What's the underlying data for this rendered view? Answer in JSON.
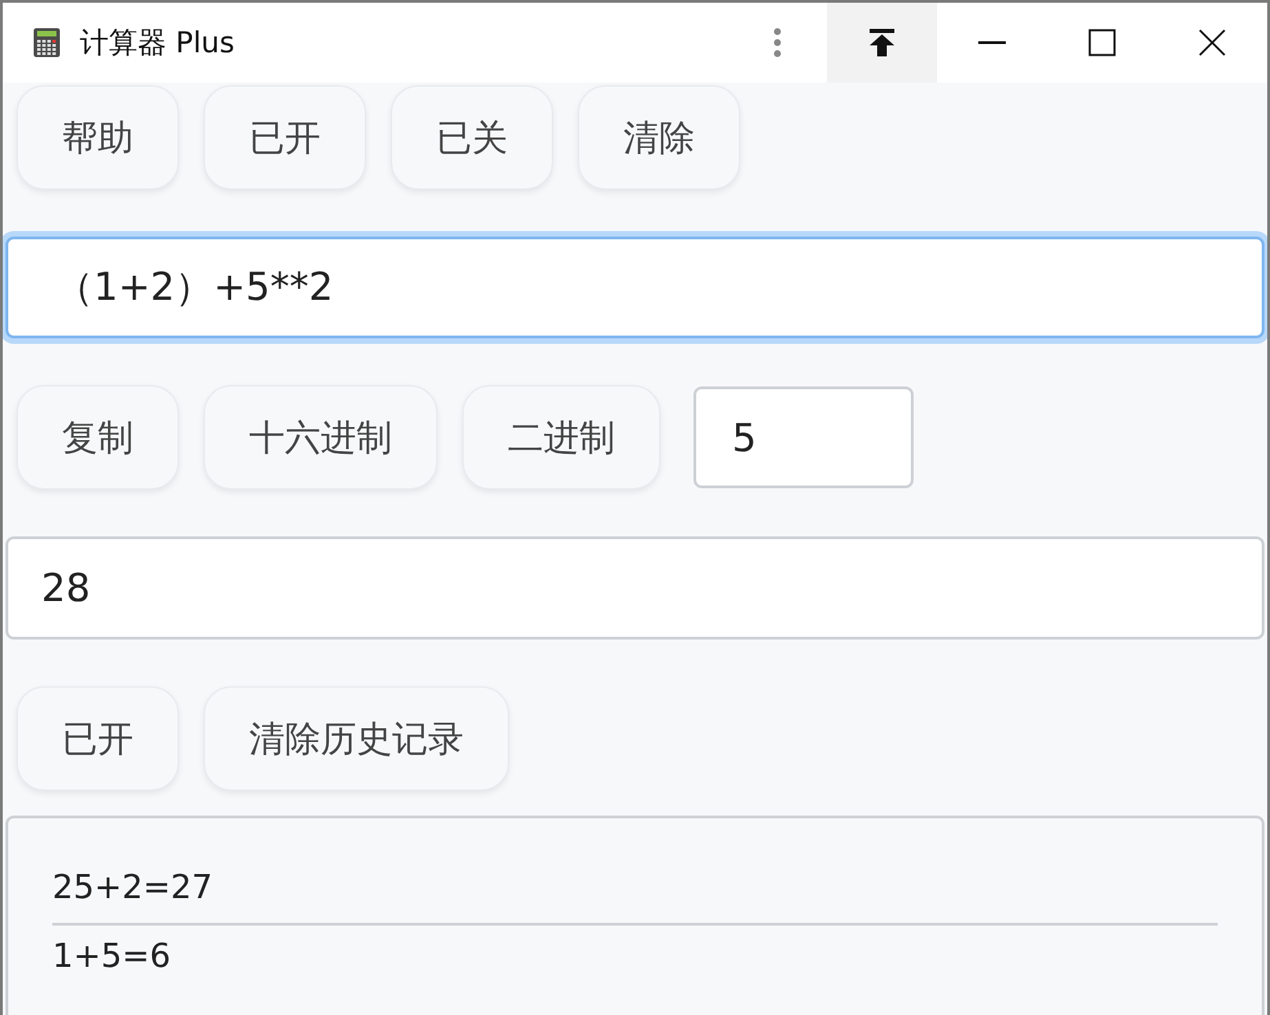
{
  "window": {
    "title": "计算器 Plus",
    "pinned": true
  },
  "top_buttons": [
    "帮助",
    "已开",
    "已关",
    "清除"
  ],
  "expression": {
    "value": "（1+2）+5**2",
    "focused": true
  },
  "convert_buttons": [
    "复制",
    "十六进制",
    "二进制"
  ],
  "digits": {
    "value": "5"
  },
  "result": {
    "value": "28"
  },
  "history_buttons": [
    "已开",
    "清除历史记录"
  ],
  "history": [
    "25+2=27",
    "1+5=6"
  ]
}
